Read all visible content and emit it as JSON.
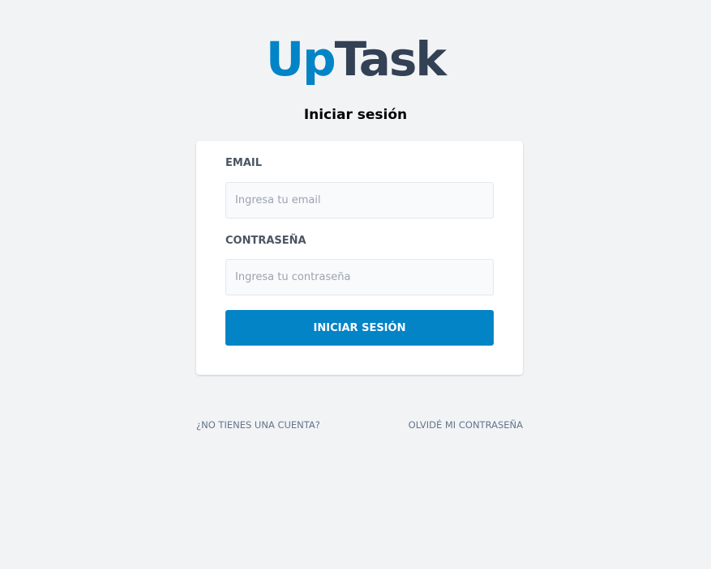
{
  "logo": {
    "part1": "Up",
    "part2": "Task"
  },
  "page_title": "Iniciar sesión",
  "form": {
    "email_label": "EMAIL",
    "email_placeholder": "Ingresa tu email",
    "email_value": "",
    "password_label": "CONTRASEÑA",
    "password_placeholder": "Ingresa tu contraseña",
    "password_value": "",
    "submit_label": "INICIAR SESIÓN"
  },
  "links": {
    "register": "¿NO TIENES UNA CUENTA?",
    "forgot": "OLVIDÉ MI CONTRASEÑA"
  },
  "colors": {
    "accent": "#0284c7",
    "logo_dark": "#334155",
    "background": "#f2f3f5"
  }
}
